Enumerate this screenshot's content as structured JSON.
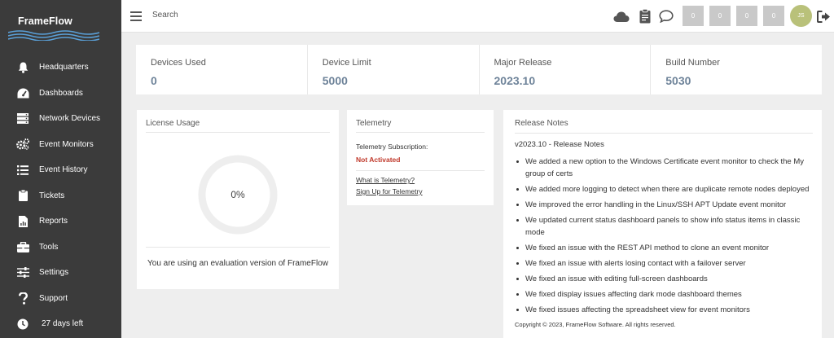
{
  "brand": {
    "name": "FrameFlow"
  },
  "sidebar": {
    "items": [
      {
        "label": "Headquarters",
        "icon": "bell-icon"
      },
      {
        "label": "Dashboards",
        "icon": "gauge-icon"
      },
      {
        "label": "Network Devices",
        "icon": "server-icon"
      },
      {
        "label": "Event Monitors",
        "icon": "gears-icon"
      },
      {
        "label": "Event History",
        "icon": "list-icon"
      },
      {
        "label": "Tickets",
        "icon": "clipboard-icon"
      },
      {
        "label": "Reports",
        "icon": "report-icon"
      },
      {
        "label": "Tools",
        "icon": "toolbox-icon"
      },
      {
        "label": "Settings",
        "icon": "sliders-icon"
      },
      {
        "label": "Support",
        "icon": "question-icon"
      },
      {
        "label": "27 days left",
        "icon": "clock-icon"
      }
    ]
  },
  "topbar": {
    "search_placeholder": "Search",
    "counters": [
      "0",
      "0",
      "0",
      "0"
    ],
    "avatar_initials": "JS"
  },
  "stats": [
    {
      "label": "Devices Used",
      "value": "0"
    },
    {
      "label": "Device Limit",
      "value": "5000"
    },
    {
      "label": "Major Release",
      "value": "2023.10"
    },
    {
      "label": "Build Number",
      "value": "5030"
    }
  ],
  "license": {
    "title": "License Usage",
    "percent_label": "0%",
    "usage_fraction": 0,
    "eval_text": "You are using an evaluation version of FrameFlow"
  },
  "telemetry": {
    "title": "Telemetry",
    "subscription_label": "Telemetry Subscription:",
    "status": "Not Activated",
    "link_what": "What is Telemetry?",
    "link_signup": "Sign Up for Telemetry"
  },
  "release_notes": {
    "title": "Release Notes",
    "heading": "v2023.10 - Release Notes",
    "items": [
      "We added a new option to the Windows Certificate event monitor to check the My group of certs",
      "We added more logging to detect when there are duplicate remote nodes deployed",
      "We improved the error handling in the Linux/SSH APT Update event monitor",
      "We updated current status dashboard panels to show info status items in classic mode",
      "We fixed an issue with the REST API method to clone an event monitor",
      "We fixed an issue with alerts losing contact with a failover server",
      "We fixed an issue with editing full-screen dashboards",
      "We fixed display issues affecting dark mode dashboard themes",
      "We fixed issues affecting the spreadsheet view for event monitors"
    ],
    "copyright": "Copyright © 2023, FrameFlow Software. All rights reserved."
  },
  "colors": {
    "sidebar_bg": "#3b3b3b",
    "stat_value": "#6e8399",
    "status_red": "#c0392b",
    "avatar_bg": "#b9c17a",
    "wave_blue": "#5aa0d8"
  }
}
